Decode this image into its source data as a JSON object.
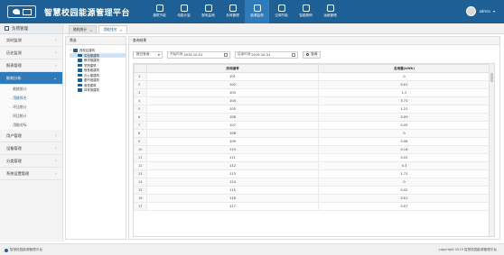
{
  "app": {
    "title": "智慧校园能源管理平台"
  },
  "topnav": [
    {
      "label": "建筑节能",
      "active": false
    },
    {
      "label": "电能计量",
      "active": false
    },
    {
      "label": "配电监测",
      "active": false
    },
    {
      "label": "负荷管理",
      "active": false
    },
    {
      "label": "能源监测",
      "active": true
    },
    {
      "label": "空调节能",
      "active": false
    },
    {
      "label": "智能照明",
      "active": false
    },
    {
      "label": "运维管理",
      "active": false
    }
  ],
  "user": {
    "name": "admin"
  },
  "sidebar": {
    "header": "负荷管理",
    "items": [
      {
        "label": "实时监测"
      },
      {
        "label": "历史监测"
      },
      {
        "label": "报表管理"
      },
      {
        "label": "能耗分析",
        "active": true,
        "children": [
          {
            "label": "能耗统计"
          },
          {
            "label": "用能排名",
            "active": true
          },
          {
            "label": "环比统计"
          },
          {
            "label": "同比统计"
          },
          {
            "label": "用能对标"
          }
        ]
      },
      {
        "label": "用户管理"
      },
      {
        "label": "设备管理"
      },
      {
        "label": "分类管理"
      },
      {
        "label": "系统设置管理"
      }
    ]
  },
  "tabs": [
    {
      "label": "能耗统计",
      "active": false
    },
    {
      "label": "用能排名",
      "active": true
    }
  ],
  "tree": {
    "header": "筛选",
    "nodes": [
      {
        "label": "西校区建筑",
        "level": 0
      },
      {
        "label": "实验楼建筑",
        "level": 1,
        "selected": true
      },
      {
        "label": "教学楼建筑",
        "level": 1
      },
      {
        "label": "学院建筑",
        "level": 1
      },
      {
        "label": "宿舍楼建筑",
        "level": 1
      },
      {
        "label": "办公楼建筑",
        "level": 1
      },
      {
        "label": "图书馆建筑",
        "level": 1
      },
      {
        "label": "食堂建筑",
        "level": 1
      },
      {
        "label": "体育馆建筑",
        "level": 1
      }
    ]
  },
  "main": {
    "header": "查询结果",
    "filter": {
      "type_value": "按日查询",
      "start_label": "开始时间",
      "start_value": "2019-10-01",
      "end_label": "结束时间",
      "end_value": "2019-10-31",
      "query_label": "查询"
    },
    "table": {
      "columns": [
        "",
        "房间编号",
        "总用量(kWh)"
      ],
      "rows": [
        [
          "1",
          "101",
          "0"
        ],
        [
          "2",
          "102",
          "0.01"
        ],
        [
          "3",
          "103",
          "1.2"
        ],
        [
          "4",
          "104",
          "5.71"
        ],
        [
          "5",
          "105",
          "1.21"
        ],
        [
          "6",
          "106",
          "0.09"
        ],
        [
          "7",
          "107",
          "0.05"
        ],
        [
          "8",
          "108",
          "0"
        ],
        [
          "9",
          "109",
          "0.08"
        ],
        [
          "10",
          "110",
          "0.14"
        ],
        [
          "11",
          "111",
          "0.02"
        ],
        [
          "12",
          "112",
          "4.3"
        ],
        [
          "13",
          "113",
          "1.71"
        ],
        [
          "14",
          "114",
          "0"
        ],
        [
          "15",
          "115",
          "0.02"
        ],
        [
          "16",
          "116",
          "0.01"
        ],
        [
          "17",
          "117",
          "0.07"
        ]
      ]
    }
  },
  "footer": {
    "left": "智慧校园能源管理平台",
    "right": "copyright 2019 智慧校园能源管理平台"
  }
}
